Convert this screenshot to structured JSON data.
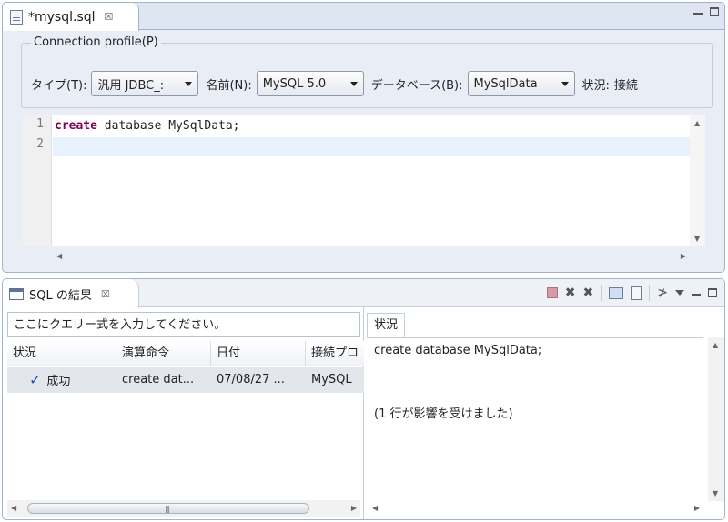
{
  "editor": {
    "tab_title": "*mysql.sql",
    "close_glyph": "☒",
    "connection_profile": {
      "legend": "Connection profile(P)",
      "type_label": "タイプ(T):",
      "type_value": "汎用 JDBC_:",
      "name_label": "名前(N):",
      "name_value": "MySQL 5.0",
      "db_label": "データベース(B):",
      "db_value": "MySqlData",
      "status_label": "状況:",
      "status_value": "接続"
    },
    "code": {
      "line_numbers": [
        "1",
        "2"
      ],
      "keyword": "create",
      "rest": " database MySqlData;"
    }
  },
  "results": {
    "tab_title": "SQL の結果",
    "close_glyph": "☒",
    "query_placeholder": "ここにクエリー式を入力してください。",
    "columns": [
      "状況",
      "演算命令",
      "日付",
      "接続プロ"
    ],
    "rows": [
      {
        "status": "成功",
        "operation": "create dat...",
        "date": "07/08/27 ...",
        "connection": "MySQL"
      }
    ],
    "status_tab": "状況",
    "status_lines": [
      "create database MySqlData;",
      "(1 行が影響を受けました)"
    ]
  },
  "icons": {
    "check": "✓",
    "remove": "✖",
    "remove_all": "✖",
    "pin": "≯",
    "grip": "|||"
  },
  "colors": {
    "keyword": "#7f0055",
    "current_line": "#e8f2fe",
    "check": "#2a4fb5",
    "view_border": "#9fb4cf"
  }
}
